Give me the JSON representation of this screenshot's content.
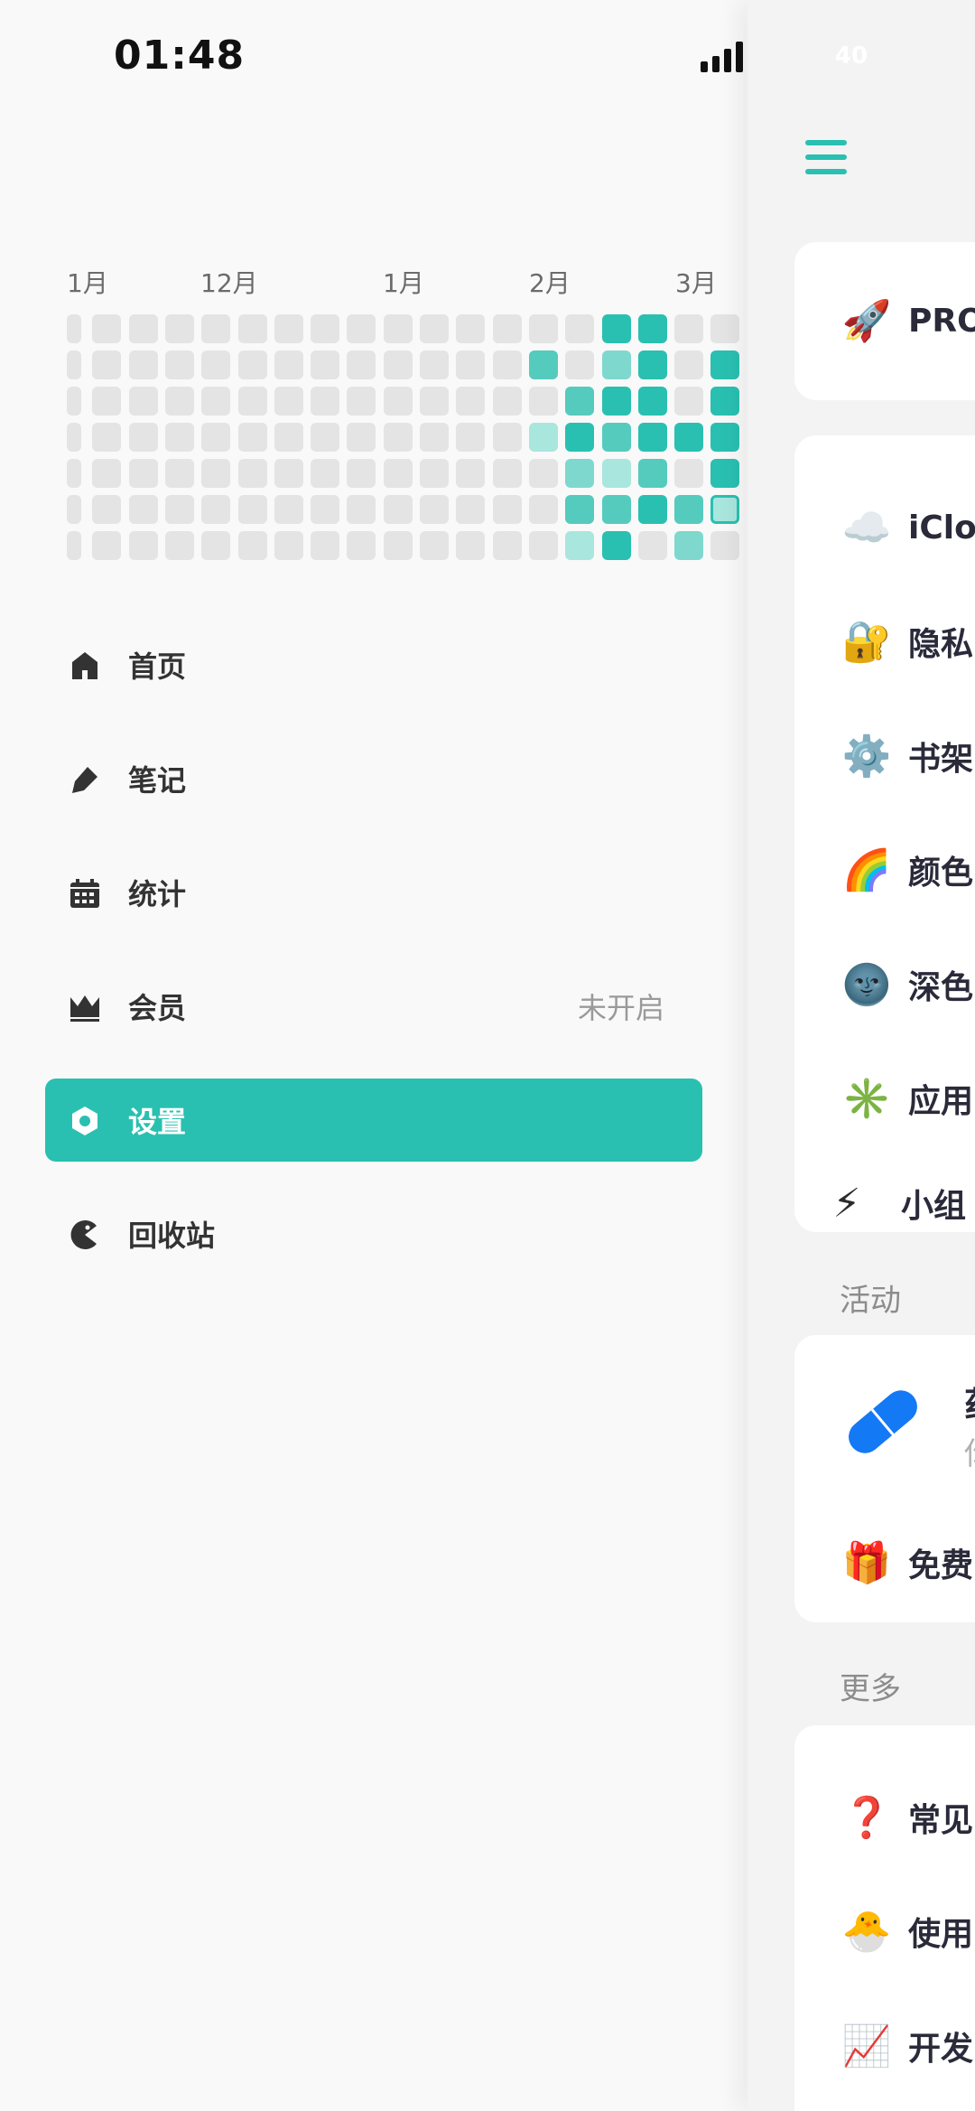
{
  "status_bar": {
    "time": "01:48",
    "battery": "40"
  },
  "heatmap": {
    "month_labels": [
      "1月",
      "12月",
      "1月",
      "2月",
      "3月"
    ],
    "colors": {
      "empty": "#e4e4e4",
      "l1": "#a9e6de",
      "l2": "#7fd8cd",
      "l3": "#55cbbd",
      "l4": "#29c0b1"
    },
    "levels": [
      [
        0,
        0,
        0,
        0,
        0,
        0,
        0,
        0,
        0,
        0,
        0,
        0,
        0,
        0,
        0,
        4,
        4,
        0,
        0
      ],
      [
        0,
        0,
        0,
        0,
        0,
        0,
        0,
        0,
        0,
        0,
        0,
        0,
        0,
        3,
        0,
        2,
        4,
        0,
        4
      ],
      [
        0,
        0,
        0,
        0,
        0,
        0,
        0,
        0,
        0,
        0,
        0,
        0,
        0,
        0,
        3,
        4,
        4,
        0,
        4
      ],
      [
        0,
        0,
        0,
        0,
        0,
        0,
        0,
        0,
        0,
        0,
        0,
        0,
        0,
        1,
        4,
        3,
        4,
        4,
        4
      ],
      [
        0,
        0,
        0,
        0,
        0,
        0,
        0,
        0,
        0,
        0,
        0,
        0,
        0,
        0,
        2,
        1,
        3,
        0,
        4
      ],
      [
        0,
        0,
        0,
        0,
        0,
        0,
        0,
        0,
        0,
        0,
        0,
        0,
        0,
        0,
        3,
        3,
        4,
        3,
        5
      ],
      [
        0,
        0,
        0,
        0,
        0,
        0,
        0,
        0,
        0,
        0,
        0,
        0,
        0,
        0,
        1,
        4,
        0,
        2,
        0
      ]
    ]
  },
  "nav": {
    "items": [
      {
        "label": "首页",
        "icon": "home-icon"
      },
      {
        "label": "笔记",
        "icon": "pen-icon"
      },
      {
        "label": "统计",
        "icon": "calendar-icon"
      },
      {
        "label": "会员",
        "value": "未开启",
        "icon": "crown-icon"
      },
      {
        "label": "设置",
        "icon": "settings-icon",
        "active": true
      },
      {
        "label": "回收站",
        "icon": "trash-icon"
      }
    ]
  },
  "panel": {
    "pro": {
      "emoji": "🚀",
      "label": "PRO"
    },
    "settings_rows": [
      {
        "emoji": "☁️",
        "label": "iClo"
      },
      {
        "emoji": "🔐",
        "label": "隐私"
      },
      {
        "emoji": "⚙️",
        "label": "书架"
      },
      {
        "emoji": "🌈",
        "label": "颜色"
      },
      {
        "emoji": "🌚",
        "label": "深色"
      },
      {
        "emoji": "✳️",
        "label": "应用"
      },
      {
        "emoji": "⚡",
        "label": "小组"
      }
    ],
    "activity_title": "活动",
    "activity": {
      "title_fragment": "药",
      "subtitle_fragment": "你",
      "gift_emoji": "🎁",
      "gift_label": "免费"
    },
    "more_title": "更多",
    "more_rows": [
      {
        "emoji": "❓",
        "label": "常见"
      },
      {
        "emoji": "🐣",
        "label": "使用"
      },
      {
        "emoji": "📈",
        "label": "开发"
      }
    ]
  }
}
